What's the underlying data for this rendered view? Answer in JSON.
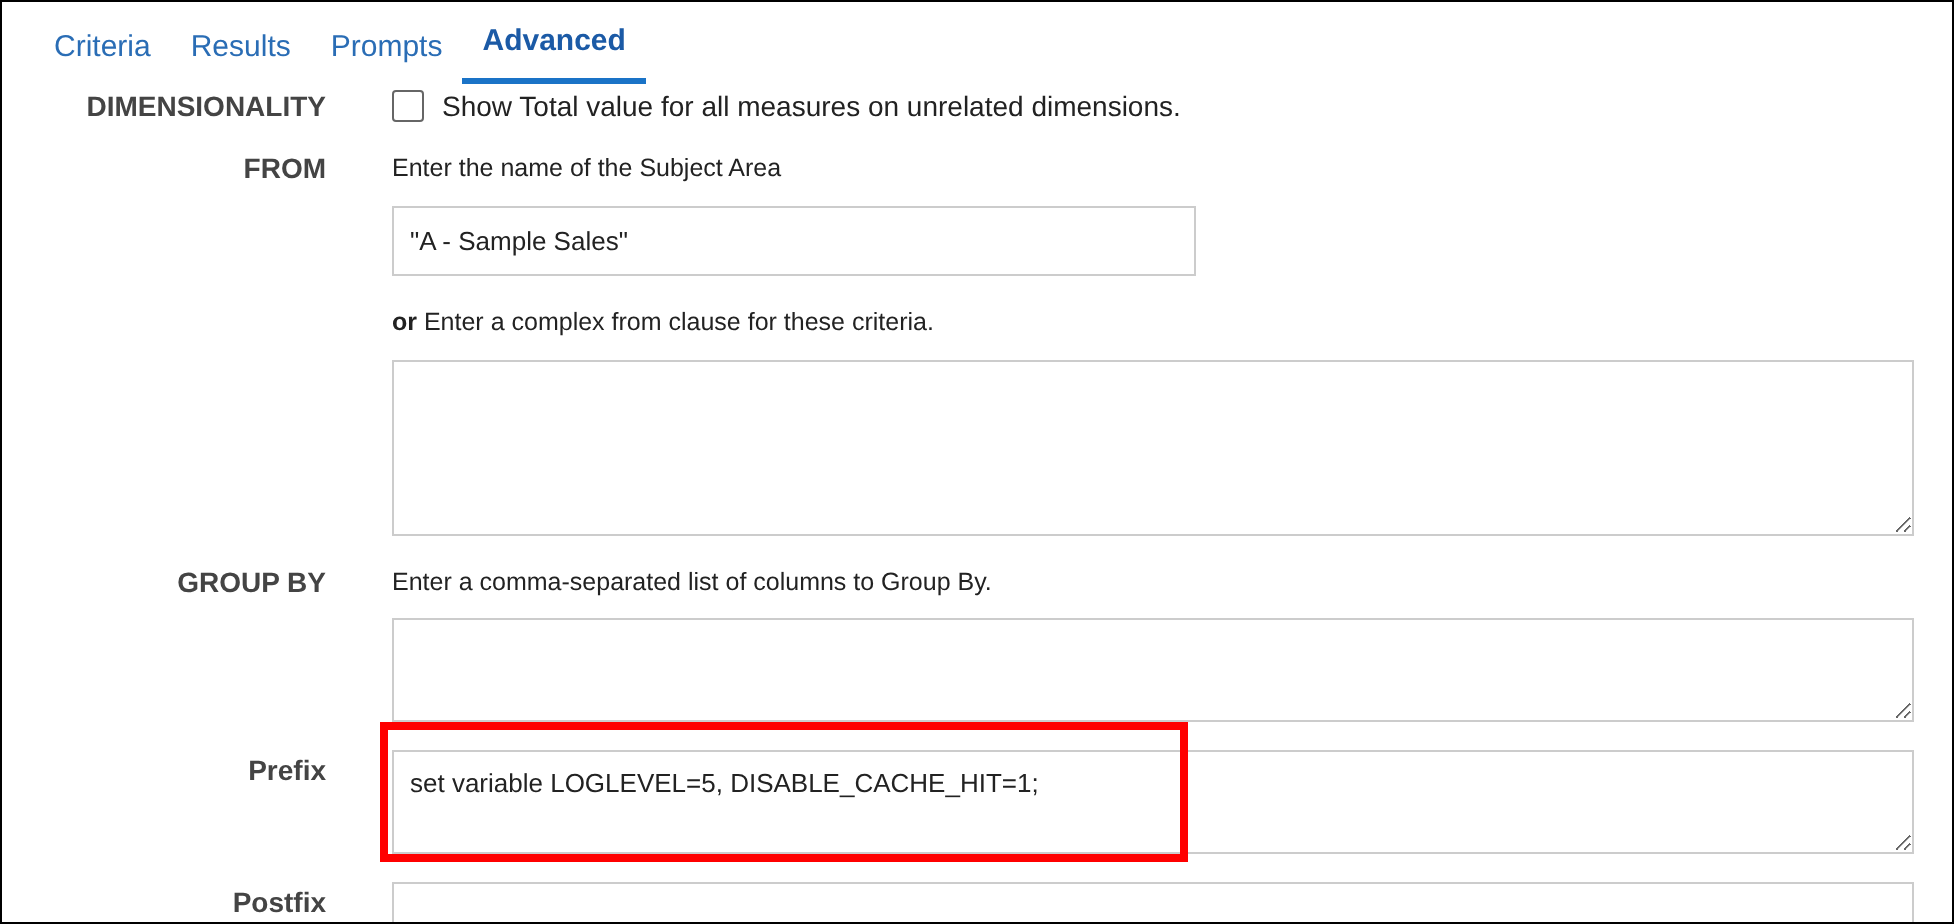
{
  "tabs": [
    {
      "label": "Criteria",
      "selected": false
    },
    {
      "label": "Results",
      "selected": false
    },
    {
      "label": "Prompts",
      "selected": false
    },
    {
      "label": "Advanced",
      "selected": true
    }
  ],
  "dimensionality": {
    "label": "DIMENSIONALITY",
    "checkbox_label": "Show Total value for all measures on unrelated dimensions.",
    "checked": false
  },
  "sections": [
    {
      "label": "FROM",
      "fields": [
        {
          "kind": "hint",
          "text": "Enter the name of the Subject Area"
        },
        {
          "kind": "input",
          "value": "\"A - Sample Sales\""
        },
        {
          "kind": "hint",
          "text": "**or** Enter a complex from clause for these criteria."
        },
        {
          "kind": "textarea",
          "highlighted": false
        }
      ]
    },
    {
      "label": "GROUP BY",
      "fields": [
        {
          "kind": "hint",
          "text": "Enter a comma-separated list of columns to Group By."
        },
        {
          "kind": "textarea",
          "highlighted": false
        }
      ]
    },
    {
      "label": "Prefix",
      "fields": [
        {
          "kind": "textarea",
          "value": "set variable LOGLEVEL=5, DISABLE_CACHE_HIT=1;",
          "highlighted": true
        }
      ]
    },
    {
      "label": "Postfix",
      "fields": [
        {
          "kind": "textarea",
          "highlighted": false
        }
      ]
    }
  ]
}
